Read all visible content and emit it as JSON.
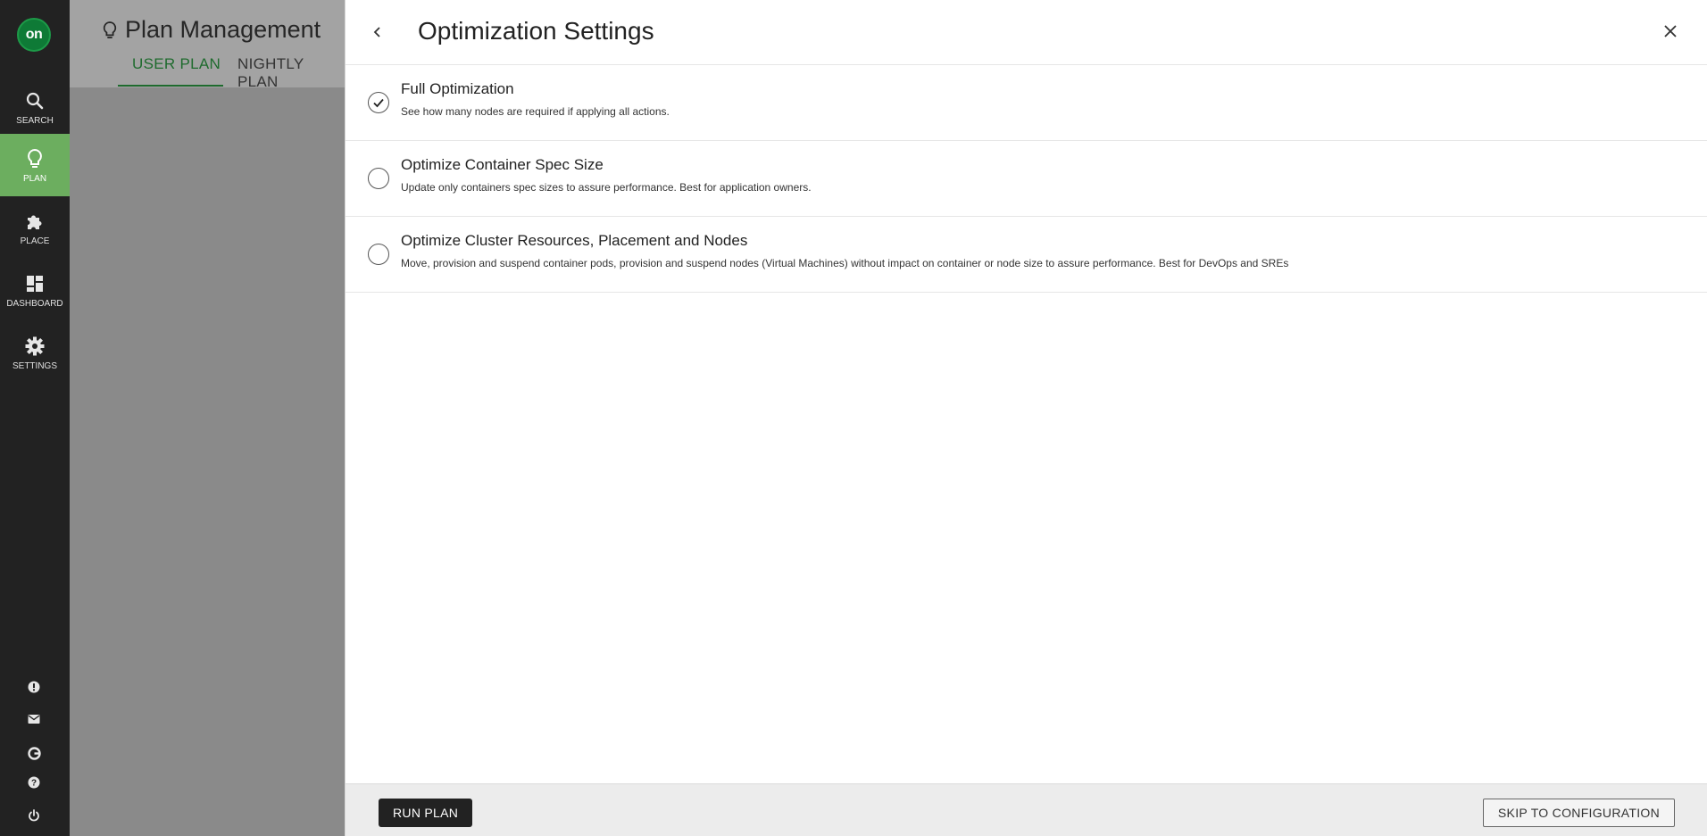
{
  "nav": {
    "logo_text": "on",
    "items": [
      {
        "label": "SEARCH",
        "icon": "search-icon"
      },
      {
        "label": "PLAN",
        "icon": "lightbulb-icon",
        "active": true
      },
      {
        "label": "PLACE",
        "icon": "puzzle-icon"
      },
      {
        "label": "DASHBOARD",
        "icon": "dashboard-icon"
      },
      {
        "label": "SETTINGS",
        "icon": "gear-icon"
      }
    ],
    "bottom_icons": [
      "alert-icon",
      "mail-icon",
      "gauge-icon",
      "help-icon",
      "power-icon"
    ],
    "active_color": "#6cae5f"
  },
  "background": {
    "title": "Plan Management",
    "tabs": [
      {
        "label": "USER PLAN",
        "active": true
      },
      {
        "label": "NIGHTLY PLAN"
      }
    ]
  },
  "panel": {
    "title": "Optimization Settings",
    "options": [
      {
        "title": "Full Optimization",
        "description": "See how many nodes are required if applying all actions.",
        "selected": true
      },
      {
        "title": "Optimize Container Spec Size",
        "description": "Update only containers spec sizes to assure performance. Best for application owners.",
        "selected": false
      },
      {
        "title": "Optimize Cluster Resources, Placement and Nodes",
        "description": "Move, provision and suspend container pods, provision and suspend nodes (Virtual Machines) without impact on container or node size to assure performance. Best for DevOps and SREs",
        "selected": false
      }
    ],
    "run_label": "RUN PLAN",
    "skip_label": "SKIP TO CONFIGURATION"
  }
}
